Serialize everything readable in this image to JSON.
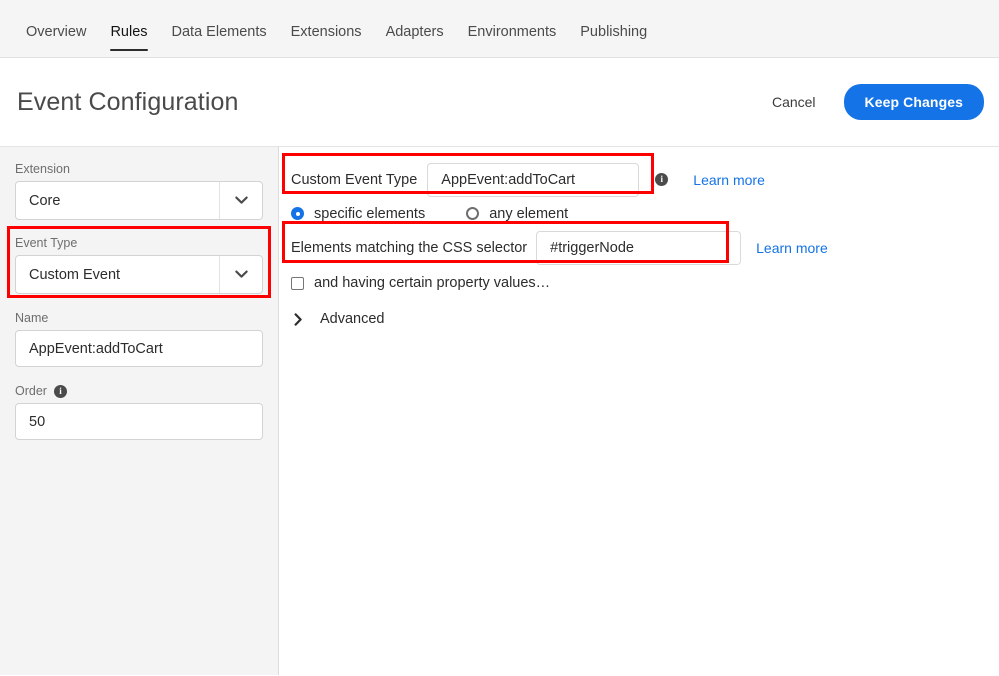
{
  "topnav": {
    "tabs": [
      {
        "label": "Overview",
        "active": false
      },
      {
        "label": "Rules",
        "active": true
      },
      {
        "label": "Data Elements",
        "active": false
      },
      {
        "label": "Extensions",
        "active": false
      },
      {
        "label": "Adapters",
        "active": false
      },
      {
        "label": "Environments",
        "active": false
      },
      {
        "label": "Publishing",
        "active": false
      }
    ]
  },
  "header": {
    "title": "Event Configuration",
    "cancel_label": "Cancel",
    "keep_changes_label": "Keep Changes",
    "accent_color": "#1473E6"
  },
  "sidebar": {
    "extension": {
      "label": "Extension",
      "value": "Core",
      "icon": "chevron-down-icon"
    },
    "event_type": {
      "label": "Event Type",
      "value": "Custom Event",
      "icon": "chevron-down-icon"
    },
    "name": {
      "label": "Name",
      "value": "AppEvent:addToCart",
      "placeholder": ""
    },
    "order": {
      "label": "Order",
      "info_icon": "info-icon",
      "value": "50",
      "placeholder": ""
    }
  },
  "main": {
    "custom_event_type": {
      "label": "Custom Event Type",
      "value": "AppEvent:addToCart",
      "placeholder": "",
      "info_icon": "info-icon",
      "learn_more": "Learn more"
    },
    "element_scope": {
      "specific_label": "specific elements",
      "any_label": "any element",
      "selected": "specific elements"
    },
    "css_selector": {
      "label": "Elements matching the CSS selector",
      "value": "#triggerNode",
      "placeholder": "",
      "learn_more": "Learn more"
    },
    "property_values": {
      "label": "and having certain property values…",
      "checked": false
    },
    "advanced": {
      "label": "Advanced",
      "icon": "chevron-right-icon",
      "expanded": false
    }
  },
  "annotations": {
    "highlight_color": "#FF0000",
    "boxes": [
      {
        "name": "highlight-event-type",
        "target": "sidebar.event_type"
      },
      {
        "name": "highlight-custom-event-type",
        "target": "main.custom_event_type"
      },
      {
        "name": "highlight-css-selector",
        "target": "main.css_selector"
      }
    ]
  }
}
